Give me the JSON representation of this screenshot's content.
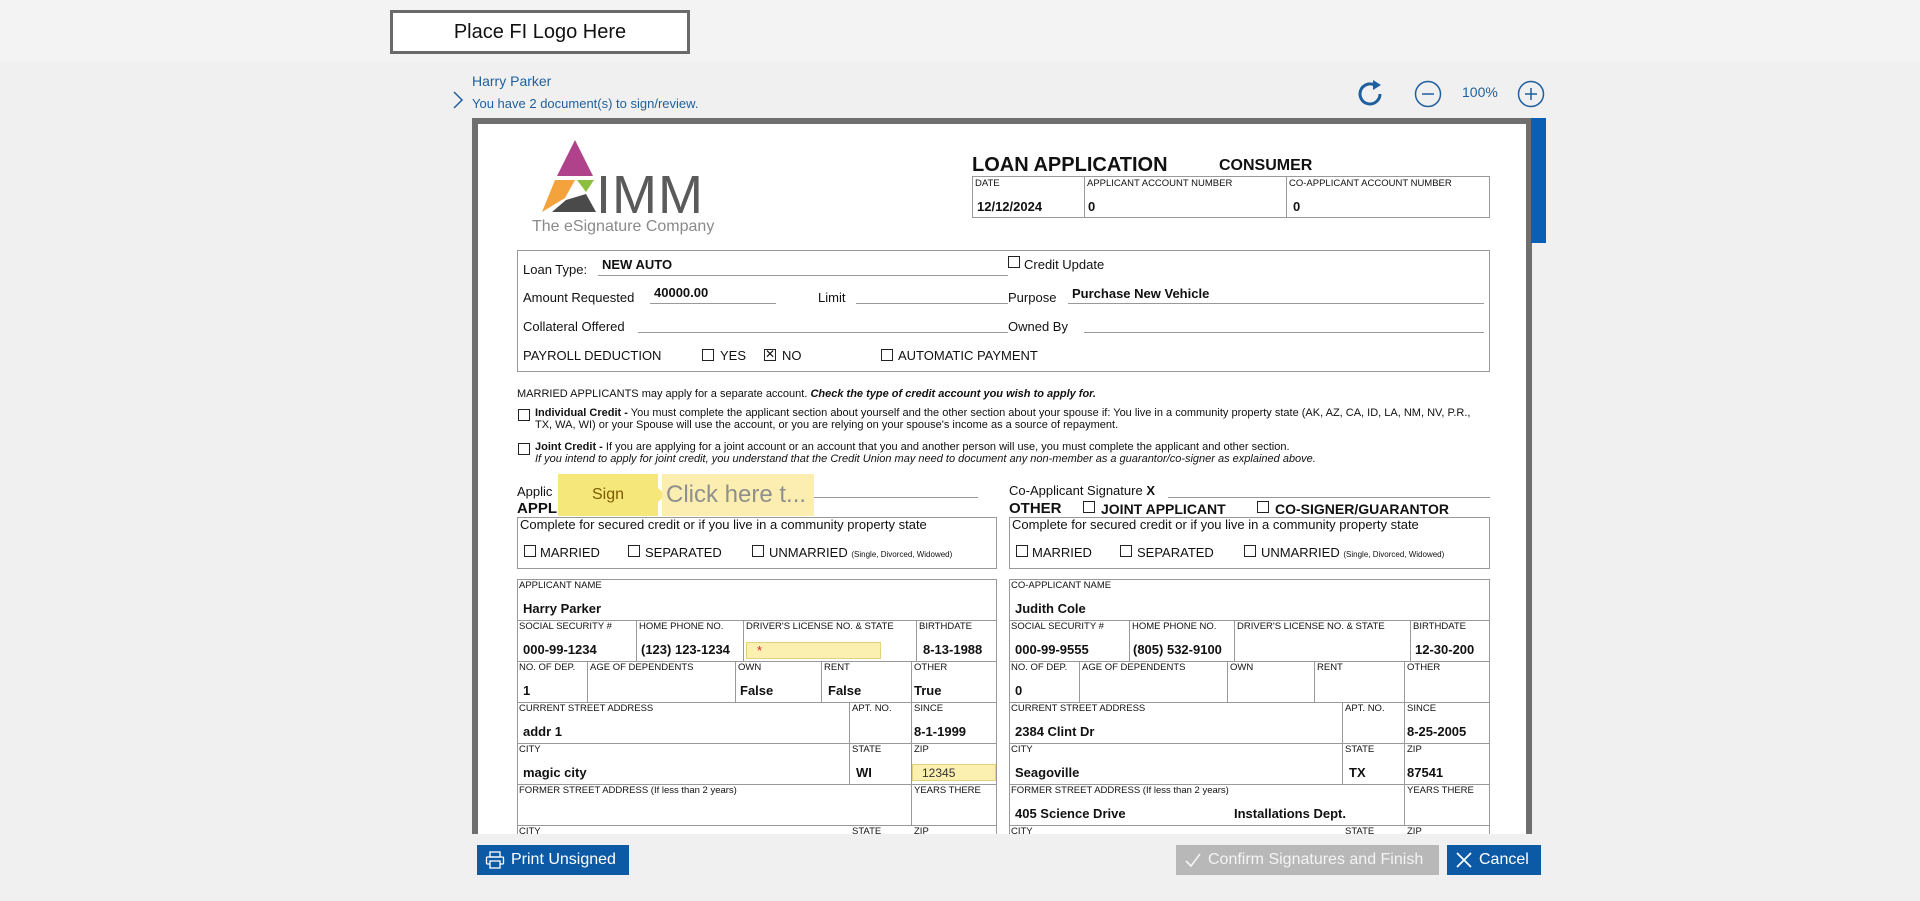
{
  "top": {
    "logo_placeholder": "Place FI Logo Here"
  },
  "header": {
    "user_name": "Harry Parker",
    "docs_message": "You have 2 document(s) to sign/review.",
    "zoom_level": "100%"
  },
  "doc": {
    "brand_tagline": "The eSignature Company",
    "brand_name": "IMM",
    "title": "LOAN APPLICATION",
    "subtitle": "CONSUMER",
    "hdr_labels": [
      "DATE",
      "APPLICANT ACCOUNT NUMBER",
      "CO-APPLICANT ACCOUNT NUMBER"
    ],
    "hdr_values": [
      "12/12/2024",
      "0",
      "0"
    ],
    "loan": {
      "loan_type_label": "Loan Type:",
      "loan_type_value": "NEW AUTO",
      "credit_update_label": "Credit Update",
      "amount_label": "Amount Requested",
      "amount_value": "40000.00",
      "limit_label": "Limit",
      "purpose_label": "Purpose",
      "purpose_value": "Purchase New Vehicle",
      "collateral_label": "Collateral Offered",
      "owned_by_label": "Owned By",
      "payroll_label": "PAYROLL DEDUCTION",
      "yes_label": "YES",
      "no_label": "NO",
      "auto_payment_label": "AUTOMATIC PAYMENT"
    },
    "married_note_a": "MARRIED APPLICANTS may apply for a separate account.",
    "married_note_b": "Check the type of credit account you wish to apply for.",
    "individual_title": "Individual Credit -",
    "individual_text": "You must complete the applicant section about yourself and the other section about your spouse if: You live in a community property state (AK, AZ, CA, ID, LA, NM, NV, P.R., TX, WA, WI) or your Spouse will use the account, or you are relying on your spouse's income as a source of repayment.",
    "joint_title": "Joint Credit -",
    "joint_text": "If you are applying for a joint account or an account that you and another person will use, you must complete the applicant and other section.",
    "joint_note": "If you intend to apply for joint credit, you understand that the Credit Union may need to document any non-member as a guarantor/co-signer as explained above.",
    "applicant_sig_label": "Applic",
    "applicant_head": "APPL",
    "sign_label": "Sign",
    "sign_placeholder": "Click here t...",
    "co_sig_label": "Co-Applicant Signature",
    "co_sig_mark": "X",
    "other_head": "OTHER",
    "joint_applicant_label": "JOINT APPLICANT",
    "cosigner_label": "CO-SIGNER/GUARANTOR",
    "secured_note": "Complete for secured credit or if you live in a community property state",
    "married_label": "MARRIED",
    "separated_label": "SEPARATED",
    "unmarried_label": "UNMARRIED",
    "unmarried_note": "(Single, Divorced, Widowed)",
    "required_mark": "*",
    "applicant": {
      "name_label": "APPLICANT NAME",
      "name": "Harry Parker",
      "ssn_label": "SOCIAL SECURITY #",
      "ssn": "000-99-1234",
      "phone_label": "HOME PHONE NO.",
      "phone": "(123) 123-1234",
      "dl_label": "DRIVER'S LICENSE NO. & STATE",
      "dl": "",
      "birth_label": "BIRTHDATE",
      "birth": "8-13-1988",
      "dep_label": "NO. OF DEP.",
      "dep": "1",
      "age_label": "AGE OF DEPENDENTS",
      "own_label": "OWN",
      "own": "False",
      "rent_label": "RENT",
      "rent": "False",
      "other_label": "OTHER",
      "other": "True",
      "street_label": "CURRENT STREET ADDRESS",
      "street": "addr 1",
      "apt_label": "APT. NO.",
      "since_label": "SINCE",
      "since": "8-1-1999",
      "city_label": "CITY",
      "city": "magic city",
      "state_label": "STATE",
      "state": "WI",
      "zip_label": "ZIP",
      "zip": "12345",
      "former_label": "FORMER STREET ADDRESS (If less than 2 years)",
      "years_label": "YEARS THERE"
    },
    "coapplicant": {
      "name_label": "CO-APPLICANT NAME",
      "name": "Judith Cole",
      "ssn": "000-99-9555",
      "phone": "(805) 532-9100",
      "birth": "12-30-200",
      "dep": "0",
      "street": "2384 Clint Dr",
      "since": "8-25-2005",
      "city": "Seagoville",
      "state": "TX",
      "zip": "87541",
      "former": "405 Science Drive",
      "former_extra": "Installations Dept."
    }
  },
  "footer": {
    "print_label": "Print Unsigned",
    "confirm_label": "Confirm Signatures and Finish",
    "cancel_label": "Cancel"
  },
  "colors": {
    "accent": "#0c5aa6",
    "link": "#1f5f9e",
    "sign": "#f6e77a",
    "field": "#fbeeb0",
    "disabled": "#b8b8b8"
  }
}
